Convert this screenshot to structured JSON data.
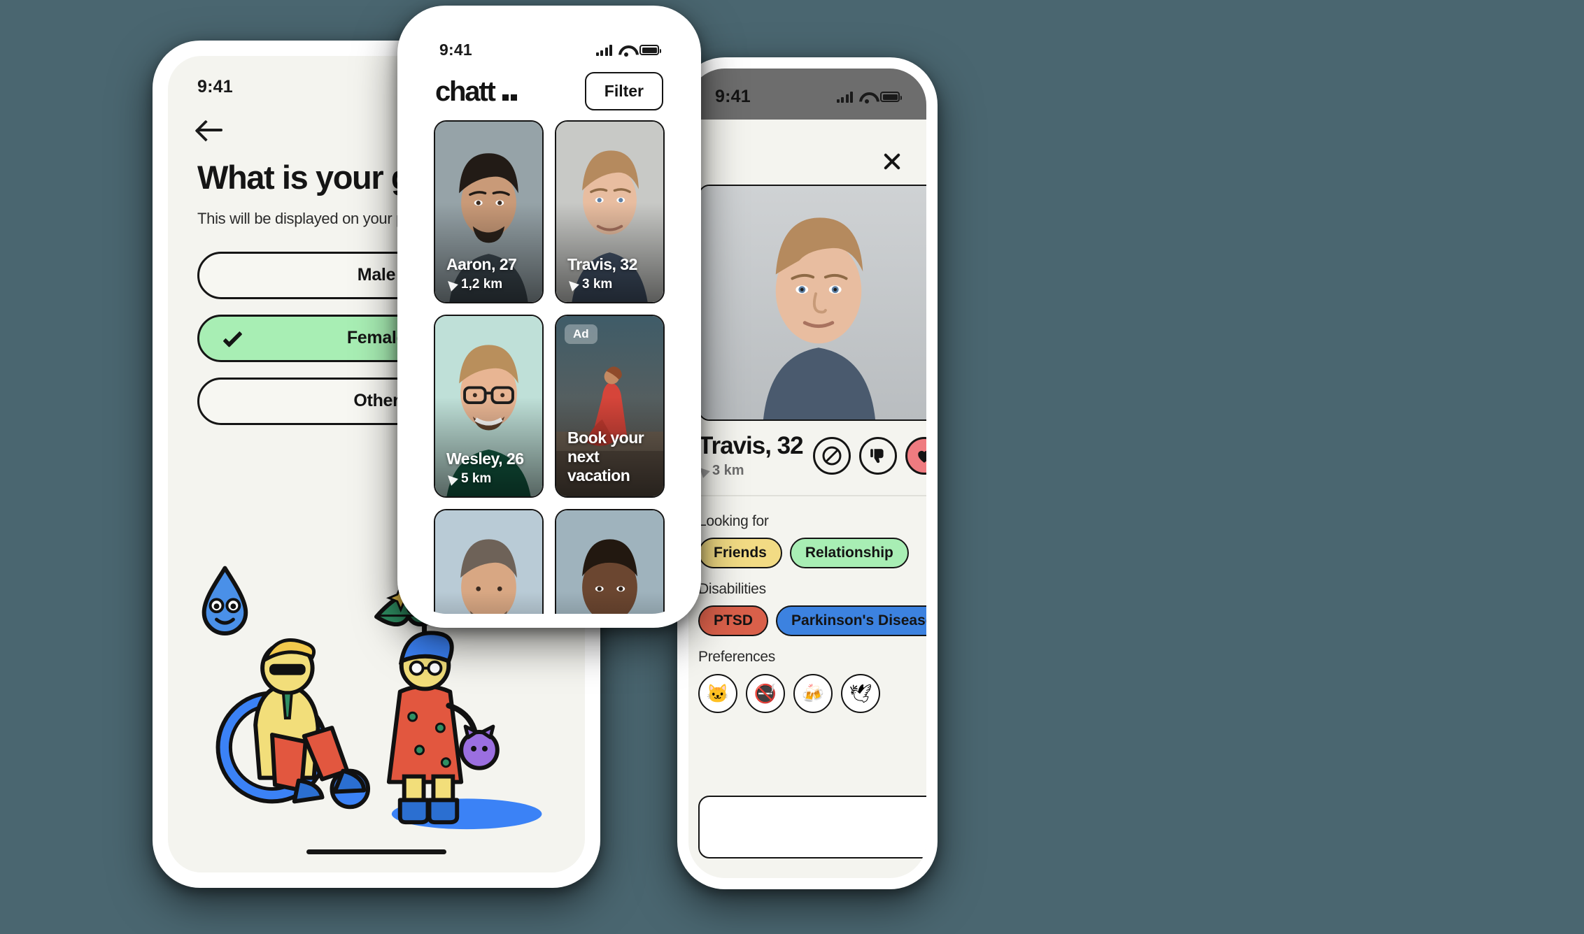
{
  "app": {
    "name": "chattii"
  },
  "phone_left": {
    "status": {
      "time": "9:41"
    },
    "back_icon": "back-arrow-icon",
    "title": "What is your gender?",
    "subtitle": "This will be displayed on your profile",
    "options": [
      {
        "label": "Male",
        "selected": false
      },
      {
        "label": "Female",
        "selected": true
      },
      {
        "label": "Other",
        "selected": false
      }
    ],
    "illustration": "wheelchair-and-umbrella-people-illustration",
    "colors": {
      "selected_bg": "#a8eeb4",
      "screen_bg": "#f4f4ef",
      "ink": "#151515"
    }
  },
  "phone_center": {
    "status": {
      "time": "9:41"
    },
    "logo": "chattii",
    "filter_label": "Filter",
    "cards": [
      {
        "type": "profile",
        "name": "Aaron, 27",
        "distance": "1,2 km"
      },
      {
        "type": "profile",
        "name": "Travis, 32",
        "distance": "3 km"
      },
      {
        "type": "profile",
        "name": "Wesley, 26",
        "distance": "5 km"
      },
      {
        "type": "ad",
        "badge": "Ad",
        "title": "Book your next vacation"
      },
      {
        "type": "profile",
        "name": "",
        "distance": ""
      },
      {
        "type": "profile",
        "name": "",
        "distance": ""
      }
    ]
  },
  "phone_right": {
    "status": {
      "time": "9:41"
    },
    "close_icon": "close-icon",
    "name": "Travis, 32",
    "distance": "3 km",
    "actions": [
      {
        "icon": "block-icon",
        "name": "block-button"
      },
      {
        "icon": "thumbs-down-icon",
        "name": "dislike-button"
      },
      {
        "icon": "heart-icon",
        "name": "like-button"
      }
    ],
    "sections": [
      {
        "label": "Looking for",
        "tags": [
          {
            "text": "Friends",
            "color": "#f2db84"
          },
          {
            "text": "Relationship",
            "color": "#a8eeb4"
          }
        ]
      },
      {
        "label": "Disabilities",
        "tags": [
          {
            "text": "PTSD",
            "color": "#d9604a"
          },
          {
            "text": "Parkinson's Disease",
            "color": "#3c82e0"
          }
        ]
      }
    ],
    "preferences_label": "Preferences",
    "preferences": [
      {
        "name": "cat-icon",
        "glyph": "🐱"
      },
      {
        "name": "no-smoking-icon",
        "glyph": "🚭"
      },
      {
        "name": "drinks-icon",
        "glyph": "🍻"
      },
      {
        "name": "love-bird-icon",
        "glyph": "🕊"
      }
    ],
    "colors": {
      "like_bg": "#ef7b80",
      "statusbar_bg": "#6d6d6d"
    }
  }
}
